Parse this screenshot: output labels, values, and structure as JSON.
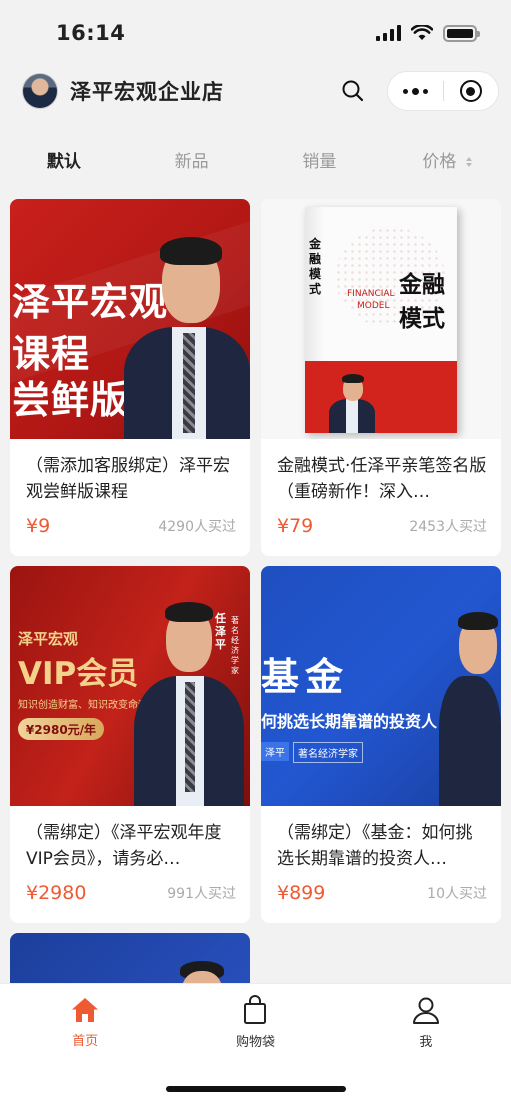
{
  "status_bar": {
    "time": "16:14"
  },
  "header": {
    "store_name": "泽平宏观企业店",
    "search_icon": "search-icon",
    "more_icon": "more-dots-icon",
    "close_icon": "target-circle-icon"
  },
  "sort_tabs": [
    {
      "label": "默认",
      "active": true
    },
    {
      "label": "新品",
      "active": false
    },
    {
      "label": "销量",
      "active": false
    },
    {
      "label": "价格",
      "active": false
    }
  ],
  "products": [
    {
      "title": "（需添加客服绑定）泽平宏观尝鲜版课程",
      "price": "¥9",
      "sold": "4290人买过",
      "image_text": [
        "泽平宏观",
        "课程",
        "尝鲜版"
      ]
    },
    {
      "title": "金融模式·任泽平亲笔签名版（重磅新作！深入…",
      "price": "¥79",
      "sold": "2453人买过",
      "image_text": [
        "金融模式",
        "FINANCIAL",
        "MODEL",
        "金融",
        "模式"
      ]
    },
    {
      "title": "（需绑定）《泽平宏观年度VIP会员》，请务必…",
      "price": "¥2980",
      "sold": "991人买过",
      "image_text": [
        "泽平宏观",
        "VIP会员",
        "知识创造财富、知识改变命运",
        "¥2980元/年",
        "任泽平",
        "著名经济学家"
      ]
    },
    {
      "title": "（需绑定）《基金：如何挑选长期靠谱的投资人…",
      "price": "¥899",
      "sold": "10人买过",
      "image_text": [
        "基金",
        "何挑选长期靠谱的投资人",
        "泽平",
        "著名经济学家"
      ]
    }
  ],
  "tabbar": [
    {
      "label": "首页",
      "icon": "home-icon",
      "active": true
    },
    {
      "label": "购物袋",
      "icon": "shopping-bag-icon",
      "active": false
    },
    {
      "label": "我",
      "icon": "user-icon",
      "active": false
    }
  ],
  "colors": {
    "accent": "#ee5a34",
    "background": "#f2f2f2"
  }
}
